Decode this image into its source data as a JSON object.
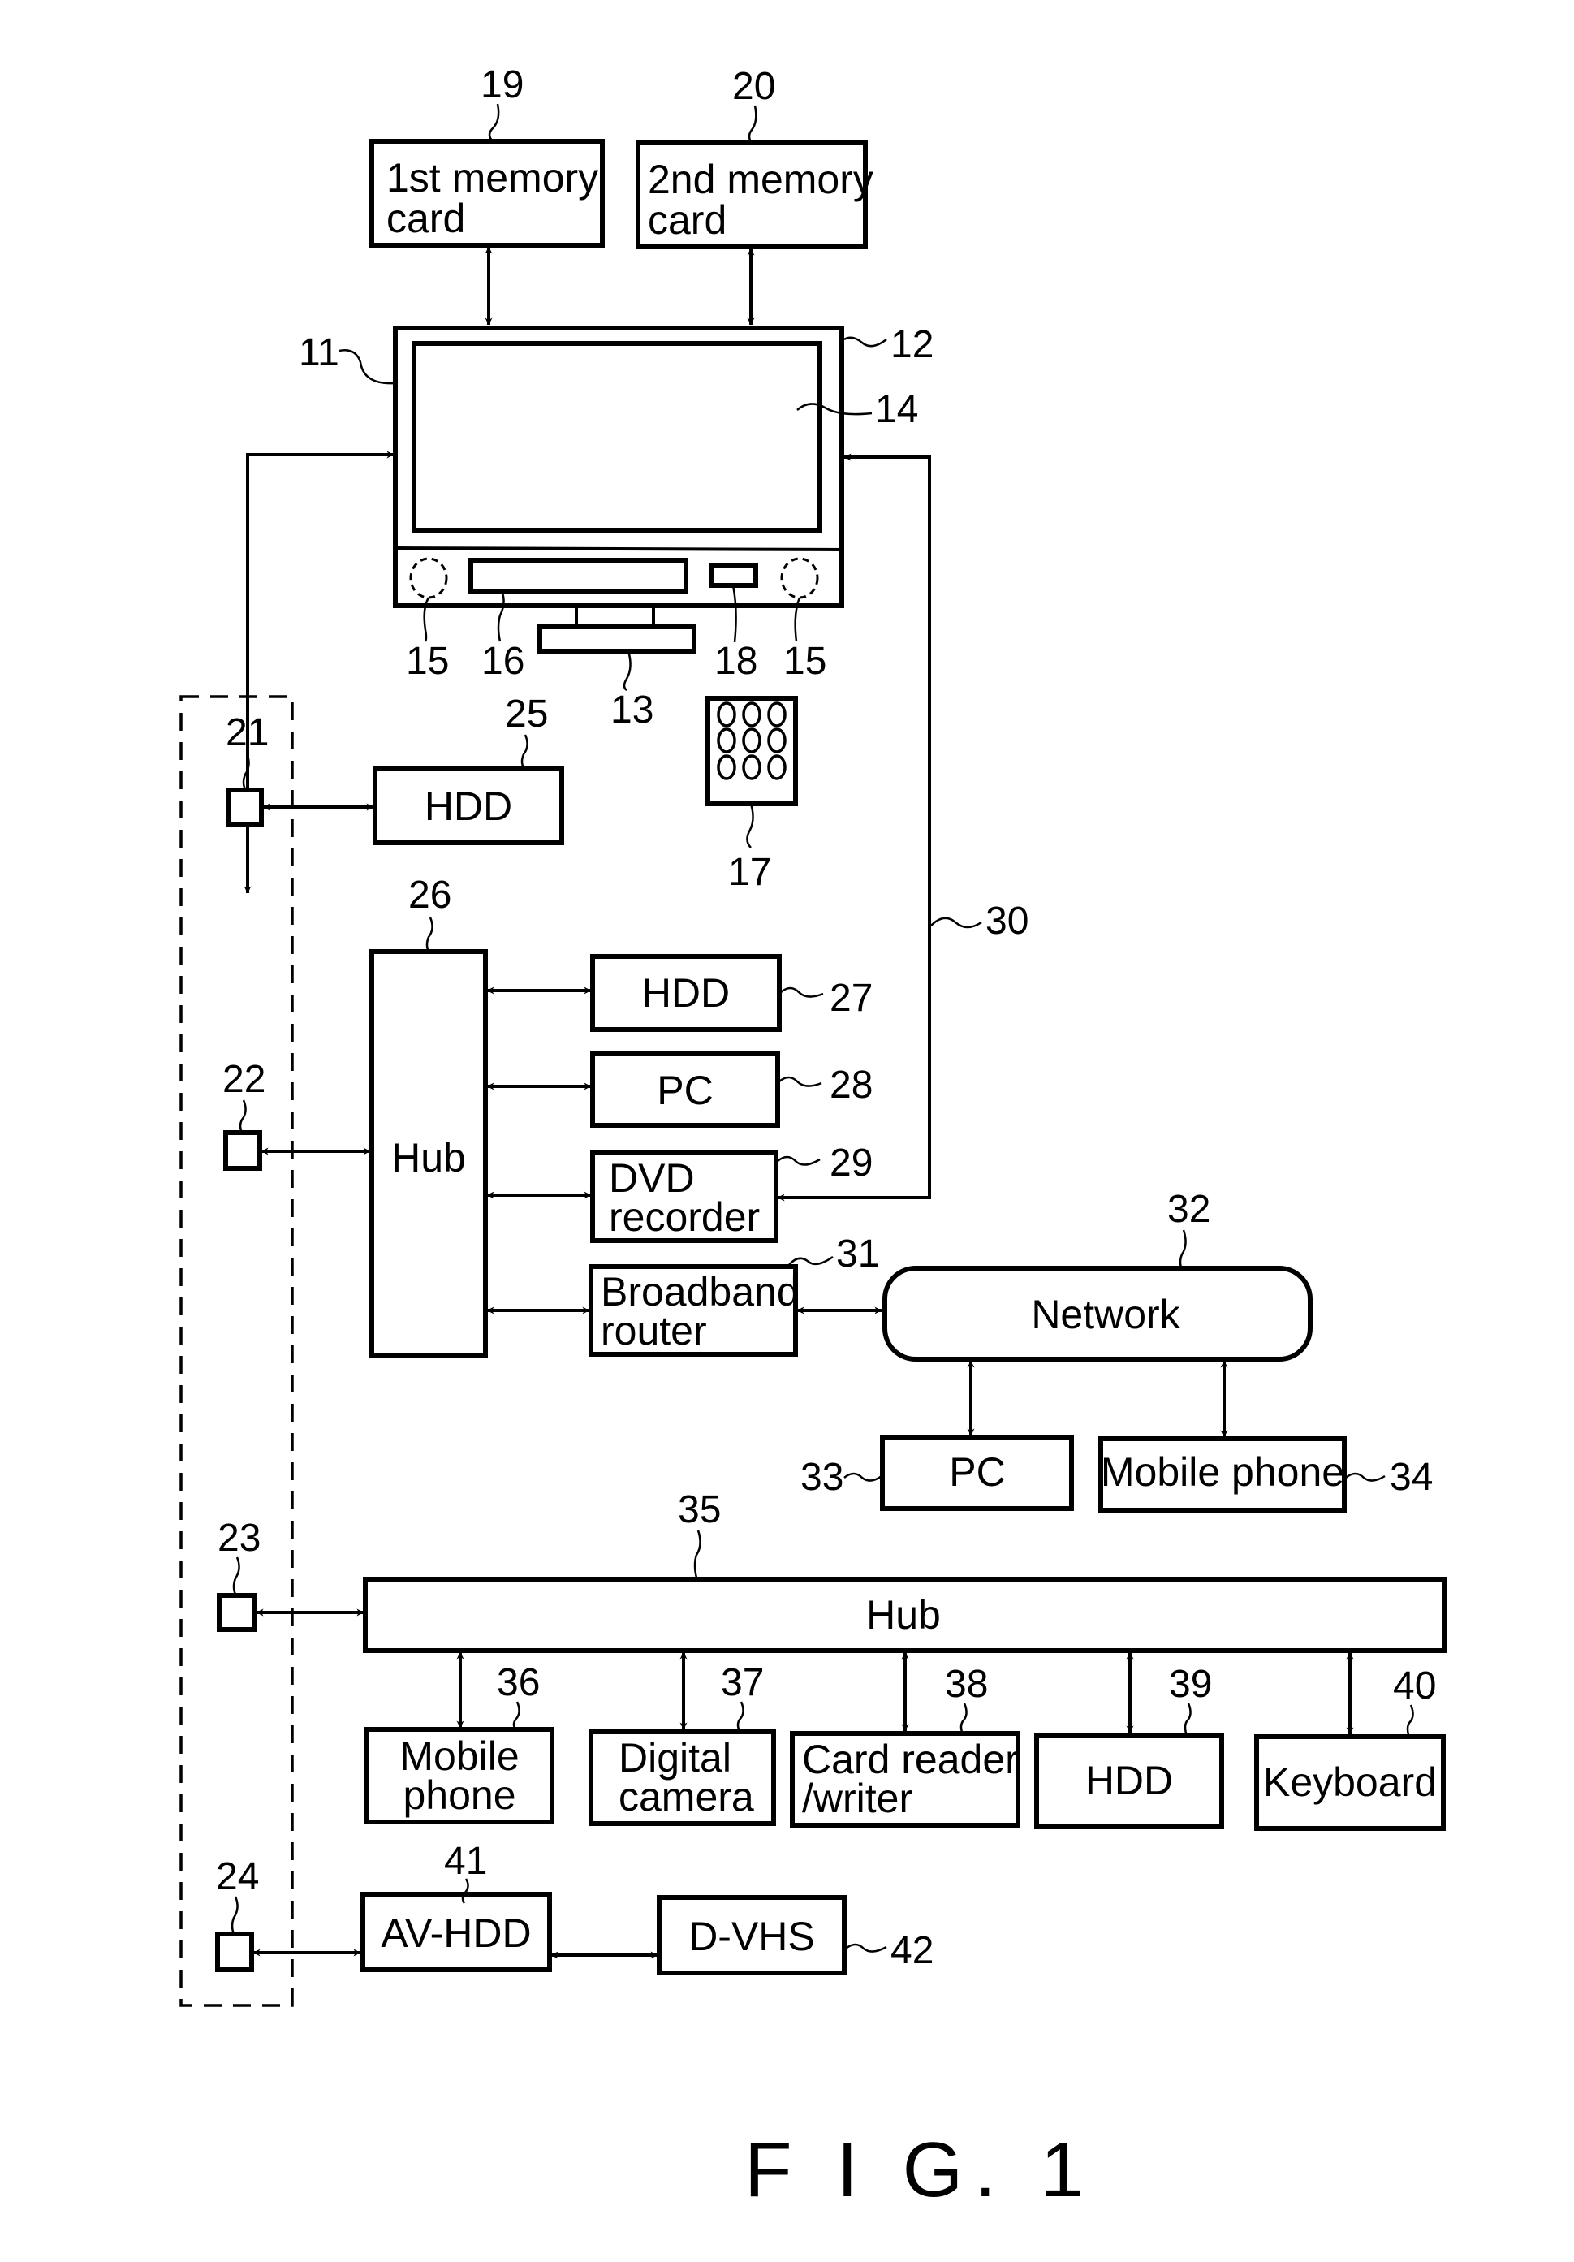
{
  "figure": {
    "caption": "F I G. 1"
  },
  "blocks": {
    "mem1": {
      "ref": "19",
      "lines": [
        "1st memory",
        "card"
      ]
    },
    "mem2": {
      "ref": "20",
      "lines": [
        "2nd memory",
        "card"
      ]
    },
    "tv": {
      "ref_cabinet": "11",
      "ref_frame": "12",
      "ref_stand": "13",
      "ref_screen": "14",
      "ref_speaker": "15",
      "ref_display_panel": "16",
      "ref_remote": "17",
      "ref_receiver": "18"
    },
    "port21": {
      "ref": "21"
    },
    "port22": {
      "ref": "22"
    },
    "port23": {
      "ref": "23"
    },
    "port24": {
      "ref": "24"
    },
    "hdd25": {
      "ref": "25",
      "label": "HDD"
    },
    "hub26": {
      "ref": "26",
      "label": "Hub"
    },
    "hdd27": {
      "ref": "27",
      "label": "HDD"
    },
    "pc28": {
      "ref": "28",
      "label": "PC"
    },
    "dvd29": {
      "ref": "29",
      "lines": [
        "DVD",
        "recorder"
      ]
    },
    "line30": {
      "ref": "30"
    },
    "router31": {
      "ref": "31",
      "lines": [
        "Broadband",
        "router"
      ]
    },
    "network32": {
      "ref": "32",
      "label": "Network"
    },
    "pc33": {
      "ref": "33",
      "label": "PC"
    },
    "mobile34": {
      "ref": "34",
      "label": "Mobile phone"
    },
    "hub35": {
      "ref": "35",
      "label": "Hub"
    },
    "mobile36": {
      "ref": "36",
      "lines": [
        "Mobile",
        "phone"
      ]
    },
    "camera37": {
      "ref": "37",
      "lines": [
        "Digital",
        "camera"
      ]
    },
    "cardrw38": {
      "ref": "38",
      "lines": [
        "Card reader",
        "/writer"
      ]
    },
    "hdd39": {
      "ref": "39",
      "label": "HDD"
    },
    "keyboard40": {
      "ref": "40",
      "label": "Keyboard"
    },
    "avhdd41": {
      "ref": "41",
      "label": "AV-HDD"
    },
    "dvhs42": {
      "ref": "42",
      "label": "D-VHS"
    }
  }
}
